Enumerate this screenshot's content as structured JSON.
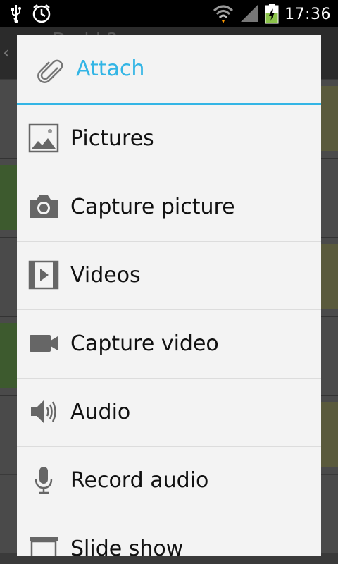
{
  "status_bar": {
    "time": "17:36",
    "icons": [
      "usb-icon",
      "alarm-icon",
      "wifi-icon",
      "signal-icon",
      "battery-charging-icon"
    ]
  },
  "background": {
    "title": "Dadd 2"
  },
  "dialog": {
    "title": "Attach",
    "title_icon": "paperclip-icon",
    "accent_color": "#33b5e5",
    "items": [
      {
        "label": "Pictures",
        "icon": "picture-icon"
      },
      {
        "label": "Capture picture",
        "icon": "camera-icon"
      },
      {
        "label": "Videos",
        "icon": "video-icon"
      },
      {
        "label": "Capture video",
        "icon": "video-camera-icon"
      },
      {
        "label": "Audio",
        "icon": "speaker-icon"
      },
      {
        "label": "Record audio",
        "icon": "microphone-icon"
      },
      {
        "label": "Slide show",
        "icon": "slideshow-icon"
      }
    ]
  }
}
